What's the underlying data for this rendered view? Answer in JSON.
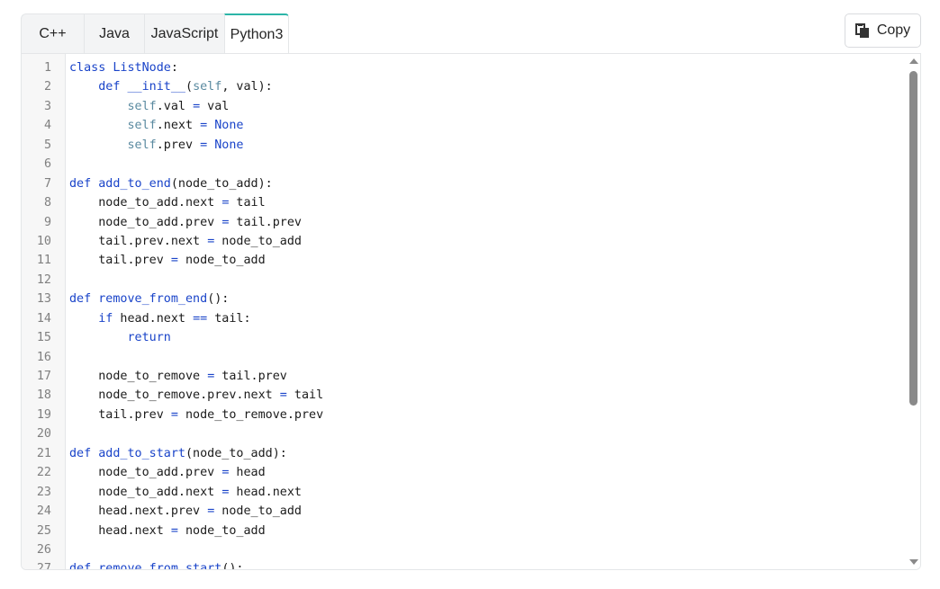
{
  "tabs": [
    {
      "label": "C++",
      "active": false
    },
    {
      "label": "Java",
      "active": false
    },
    {
      "label": "JavaScript",
      "active": false
    },
    {
      "label": "Python3",
      "active": true
    }
  ],
  "copy_button": {
    "label": "Copy",
    "icon": "copy-icon"
  },
  "code": {
    "language": "Python3",
    "lines": [
      "class ListNode:",
      "    def __init__(self, val):",
      "        self.val = val",
      "        self.next = None",
      "        self.prev = None",
      "",
      "def add_to_end(node_to_add):",
      "    node_to_add.next = tail",
      "    node_to_add.prev = tail.prev",
      "    tail.prev.next = node_to_add",
      "    tail.prev = node_to_add",
      "",
      "def remove_from_end():",
      "    if head.next == tail:",
      "        return",
      "",
      "    node_to_remove = tail.prev",
      "    node_to_remove.prev.next = tail",
      "    tail.prev = node_to_remove.prev",
      "",
      "def add_to_start(node_to_add):",
      "    node_to_add.prev = head",
      "    node_to_add.next = head.next",
      "    head.next.prev = node_to_add",
      "    head.next = node_to_add",
      "",
      "def remove_from_start():"
    ]
  },
  "colors": {
    "active_tab_accent": "#2cb5a8",
    "keyword": "#1a44c9",
    "self": "#5a8aa0"
  }
}
